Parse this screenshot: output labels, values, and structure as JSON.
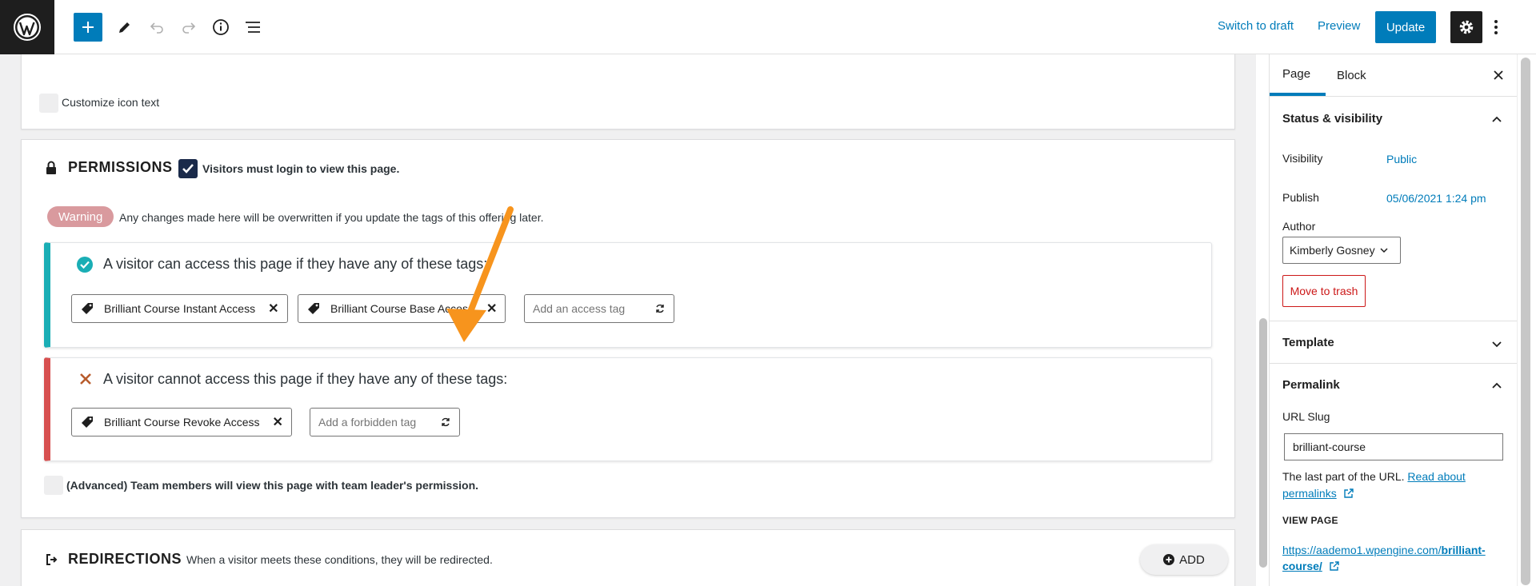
{
  "toolbar": {
    "switch_draft": "Switch to draft",
    "preview": "Preview",
    "update": "Update",
    "icons": [
      "wordpress-logo",
      "plus-icon",
      "pencil-icon",
      "undo-icon",
      "redo-icon",
      "info-icon",
      "list-view-icon",
      "gear-icon",
      "more-vertical-icon"
    ]
  },
  "editor": {
    "customize_icon_text": "Customize icon text",
    "permissions": {
      "title": "PERMISSIONS",
      "login_required_label": "Visitors must login to view this page.",
      "login_required_checked": true,
      "warning_badge": "Warning",
      "warning_text": "Any changes made here will be overwritten if you update the tags of this offering later.",
      "allow_rule": {
        "heading": "A visitor can access this page if they have any of these tags:",
        "tags": [
          "Brilliant Course Instant Access",
          "Brilliant Course Base Access"
        ],
        "placeholder": "Add an access tag"
      },
      "deny_rule": {
        "heading": "A visitor cannot access this page if they have any of these tags:",
        "tags": [
          "Brilliant Course Revoke Access"
        ],
        "placeholder": "Add a forbidden tag"
      },
      "advanced_label": "(Advanced) Team members will view this page with team leader's permission."
    },
    "redirections": {
      "title": "REDIRECTIONS",
      "description": "When a visitor meets these conditions, they will be redirected.",
      "add_label": "ADD"
    }
  },
  "sidebar": {
    "tabs": [
      "Page",
      "Block"
    ],
    "active_tab": "Page",
    "status_heading": "Status & visibility",
    "visibility_label": "Visibility",
    "visibility_value": "Public",
    "publish_label": "Publish",
    "publish_value": "05/06/2021 1:24 pm",
    "author_label": "Author",
    "author_value": "Kimberly Gosney",
    "trash_label": "Move to trash",
    "template_heading": "Template",
    "permalink_heading": "Permalink",
    "url_slug_label": "URL Slug",
    "url_slug_value": "brilliant-course",
    "help_text": "The last part of the URL.",
    "help_link": "Read about permalinks",
    "view_page_label": "VIEW PAGE",
    "view_url_prefix": "https://aademo1.wpengine.com/",
    "view_url_slug": "brilliant-course/"
  },
  "colors": {
    "accent": "#007cba",
    "allow_border": "#1aaeb5",
    "deny_border": "#d75050",
    "warning": "#d99a9e",
    "arrow": "#f7941d",
    "trash": "#cc1818"
  }
}
